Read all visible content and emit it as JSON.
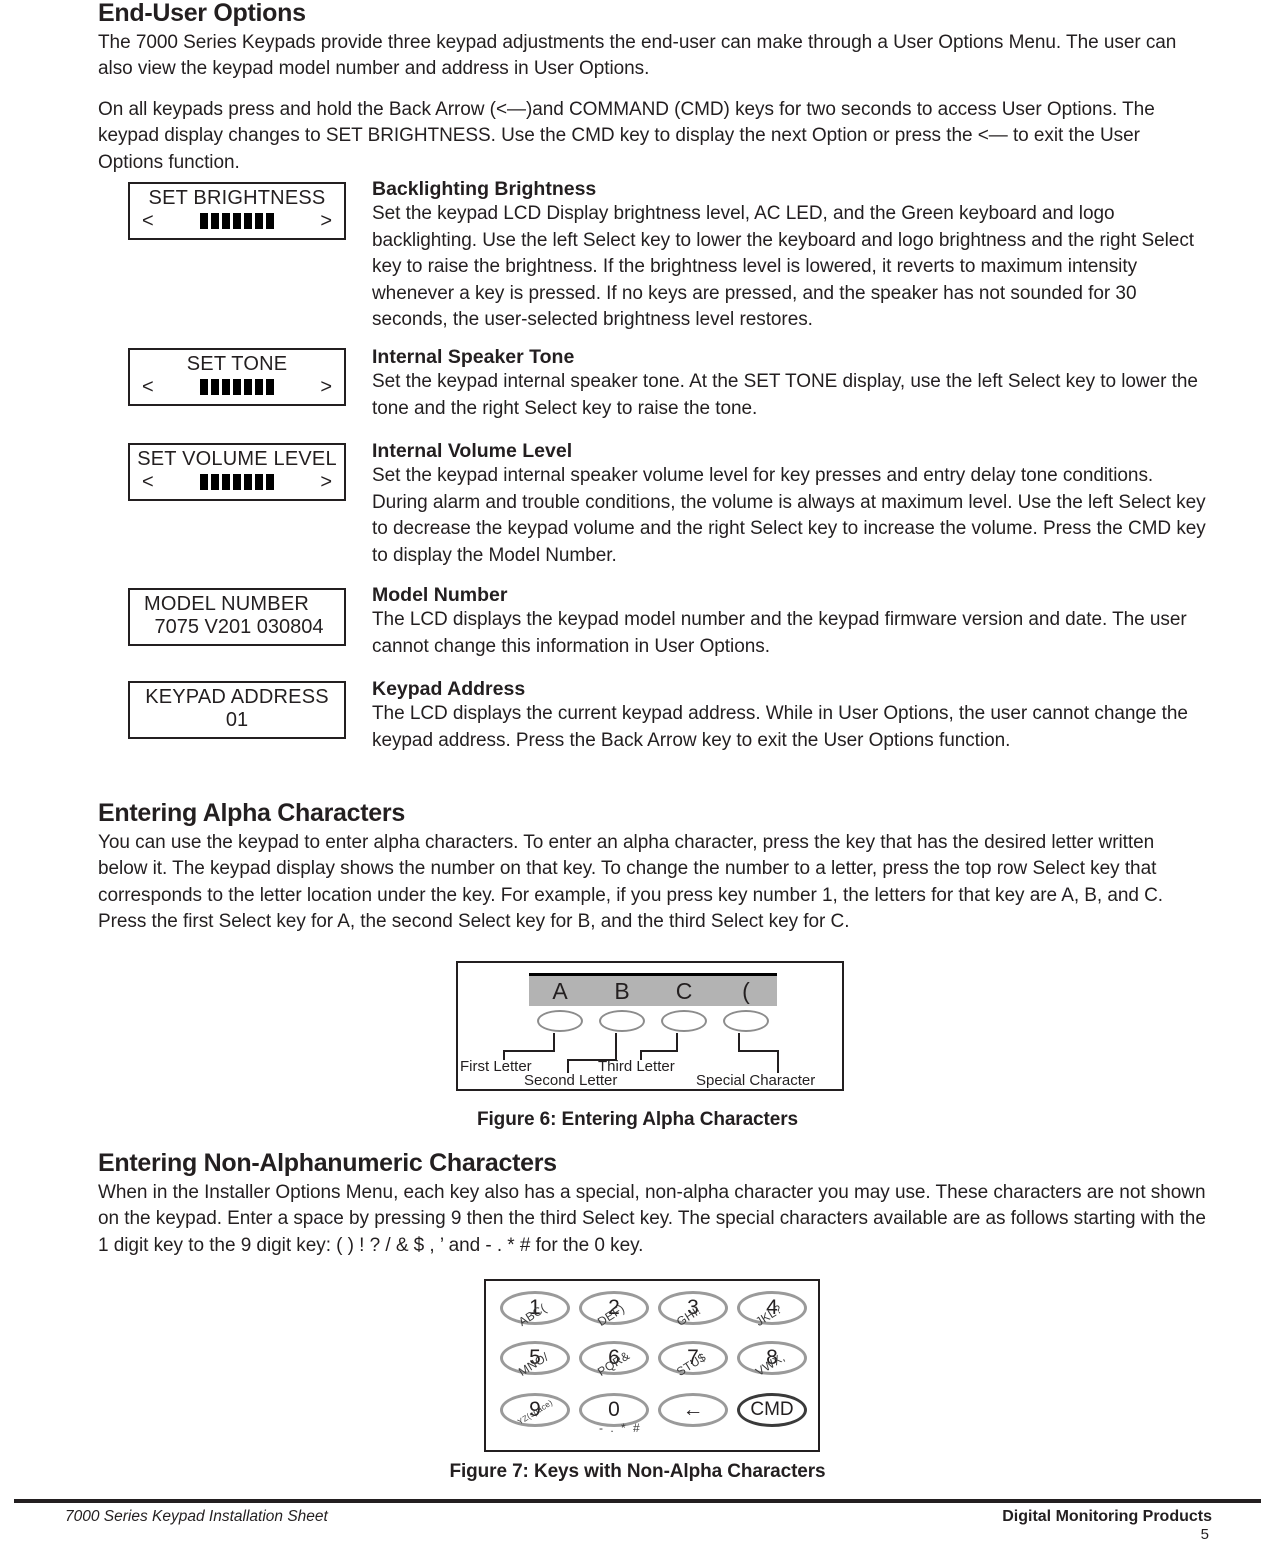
{
  "section": {
    "title": "End-User Options",
    "para1": "The 7000 Series Keypads provide three keypad adjustments the end-user can make through a User Options Menu. The user can also view the keypad model number and address in User Options.",
    "para2": "On all keypads press and hold the Back Arrow (<—)and COMMAND (CMD) keys for two seconds to access User Options. The keypad display changes to SET BRIGHTNESS.  Use the CMD key to display the next Option or press the <— to exit the User Options function."
  },
  "options": [
    {
      "lcd": {
        "line1": "SET BRIGHTNESS",
        "left_arrow": "<",
        "right_arrow": ">",
        "bars": 7
      },
      "heading": "Backlighting Brightness",
      "body": "Set the keypad LCD Display brightness level, AC LED, and the Green keyboard and logo backlighting.  Use the left Select key to lower the keyboard and logo brightness and the right Select key to raise the brightness.  If the brightness level is lowered, it reverts to maximum intensity whenever a key is pressed.  If no keys are pressed, and the speaker has not sounded for 30 seconds, the user-selected brightness level restores."
    },
    {
      "lcd": {
        "line1": "SET TONE",
        "left_arrow": "<",
        "right_arrow": ">",
        "bars": 7
      },
      "heading": "Internal Speaker Tone",
      "body": "Set the keypad internal speaker tone.  At the SET TONE display, use the left Select key to lower the tone and the right Select key to raise the tone."
    },
    {
      "lcd": {
        "line1": "SET VOLUME LEVEL",
        "left_arrow": "<",
        "right_arrow": ">",
        "bars": 7
      },
      "heading": "Internal Volume Level",
      "body": "Set the keypad internal speaker volume level for key presses and entry delay tone conditions.  During alarm and trouble conditions, the volume is always at maximum level.  Use the left Select key to decrease the keypad volume and the right Select key to increase the volume.  Press the CMD key to display the Model Number."
    },
    {
      "lcd": {
        "line1": "MODEL NUMBER",
        "line2": "7075     V201    030804"
      },
      "heading": "Model Number",
      "body": "The LCD displays the keypad model number and the keypad firmware version and date. The user cannot change this information in User Options."
    },
    {
      "lcd": {
        "line1": "KEYPAD ADDRESS",
        "line2": "01"
      },
      "heading": "Keypad Address",
      "body": "The LCD displays the current keypad address.  While in User Options, the user cannot change the keypad address.  Press the Back Arrow key to exit the User Options function."
    }
  ],
  "alpha": {
    "title": "Entering Alpha Characters",
    "body": "You can use the keypad to enter alpha characters.  To enter an alpha character, press the key that has the desired letter written below it.  The keypad display shows the number on that key. To change the number to a letter, press the top row Select key that corresponds to the letter location under the key. For example, if you press key number 1, the letters for that key are A, B, and C. Press the first Select key for A, the second Select key for B, and the third Select key for C."
  },
  "figure6": {
    "caption": "Figure 6: Entering Alpha Characters",
    "display_chars": [
      "A",
      "B",
      "C",
      "("
    ],
    "labels": {
      "first": "First Letter",
      "second": "Second Letter",
      "third": "Third Letter",
      "special": "Special Character"
    },
    "lcd_bg_color": "#b3b3b3"
  },
  "nonalpha": {
    "title": "Entering Non-Alphanumeric Characters",
    "body": "When in the Installer Options Menu, each key also has a special, non-alpha character you may use.  These characters are not shown on the keypad.  Enter a space by pressing 9 then the third Select key.  The special characters available are as follows starting with the 1 digit key to the 9 digit key: ( ) ! ? / & $ , ’ and - . * # for the 0 key."
  },
  "figure7": {
    "caption": "Figure 7: Keys with Non-Alpha Characters",
    "rows": [
      [
        {
          "key": "1",
          "sub": "ABC("
        },
        {
          "key": "2",
          "sub": "DEF)"
        },
        {
          "key": "3",
          "sub": "GHI!"
        },
        {
          "key": "4",
          "sub": "JKL?"
        }
      ],
      [
        {
          "key": "5",
          "sub": "MNO/"
        },
        {
          "key": "6",
          "sub": "PQR&"
        },
        {
          "key": "7",
          "sub": "STU$"
        },
        {
          "key": "8",
          "sub": "VWX,"
        }
      ],
      [
        {
          "key": "9",
          "sub": "YZ(space)"
        },
        {
          "key": "0",
          "sub": "- . * #"
        },
        {
          "key": "←",
          "sub": ""
        },
        {
          "key": "CMD",
          "sub": ""
        }
      ]
    ]
  },
  "footer": {
    "left": "7000 Series Keypad Installation Sheet",
    "right": "Digital Monitoring Products",
    "page": "5"
  }
}
